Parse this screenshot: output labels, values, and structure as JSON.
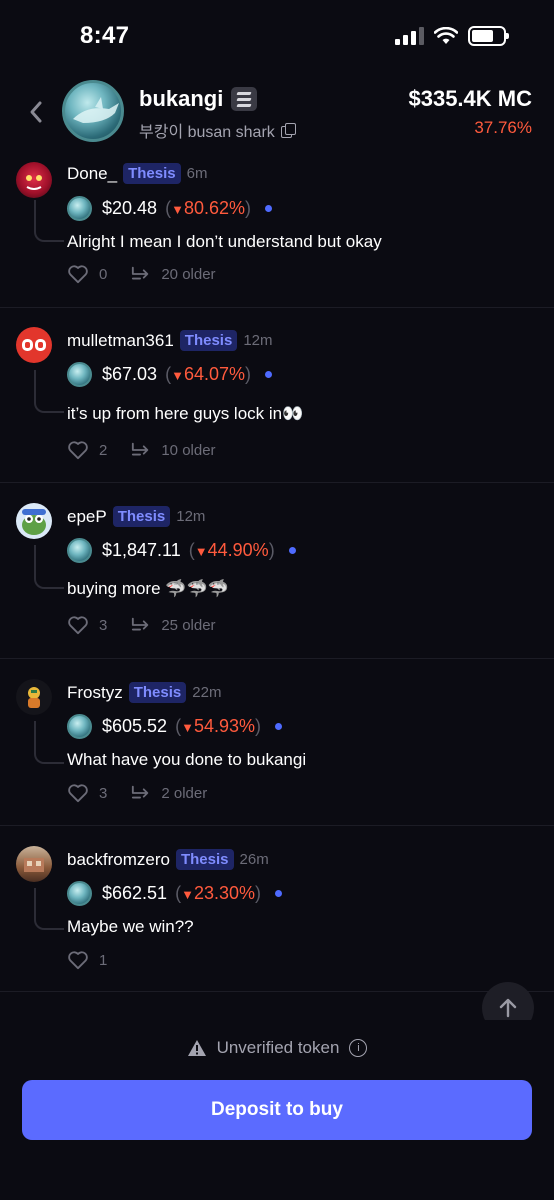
{
  "status": {
    "time": "8:47"
  },
  "header": {
    "token_name": "bukangi",
    "token_subtitle": "부캉이 busan shark",
    "market_cap": "$335.4K MC",
    "change": "37.76%"
  },
  "posts": [
    {
      "username": "Done_",
      "tag": "Thesis",
      "time": "6m",
      "price": "$20.48",
      "delta": "80.62%",
      "text": "Alright I mean I don’t understand but okay",
      "likes": "0",
      "replies": "20 older"
    },
    {
      "username": "mulletman361",
      "tag": "Thesis",
      "time": "12m",
      "price": "$67.03",
      "delta": "64.07%",
      "text": "it’s up from here guys lock in👀",
      "likes": "2",
      "replies": "10 older"
    },
    {
      "username": "epeP",
      "tag": "Thesis",
      "time": "12m",
      "price": "$1,847.11",
      "delta": "44.90%",
      "text": "buying more 🦈🦈🦈",
      "likes": "3",
      "replies": "25 older"
    },
    {
      "username": "Frostyz",
      "tag": "Thesis",
      "time": "22m",
      "price": "$605.52",
      "delta": "54.93%",
      "text": "What have you done to bukangi",
      "likes": "3",
      "replies": "2 older"
    },
    {
      "username": "backfromzero",
      "tag": "Thesis",
      "time": "26m",
      "price": "$662.51",
      "delta": "23.30%",
      "text": "Maybe we win??",
      "likes": "1",
      "replies": ""
    }
  ],
  "bottom": {
    "warning": "Unverified token",
    "info_glyph": "i",
    "deposit_label": "Deposit to buy"
  },
  "colors": {
    "accent": "#5b6bff",
    "negative": "#ff5a3d",
    "thesis_bg": "#1e2565",
    "thesis_fg": "#7f8cff"
  },
  "icons": [
    "signal-icon",
    "wifi-icon",
    "battery-icon",
    "back-icon",
    "chain-icon",
    "copy-icon",
    "heart-icon",
    "reply-icon",
    "arrow-up-icon",
    "warning-icon",
    "info-icon"
  ]
}
